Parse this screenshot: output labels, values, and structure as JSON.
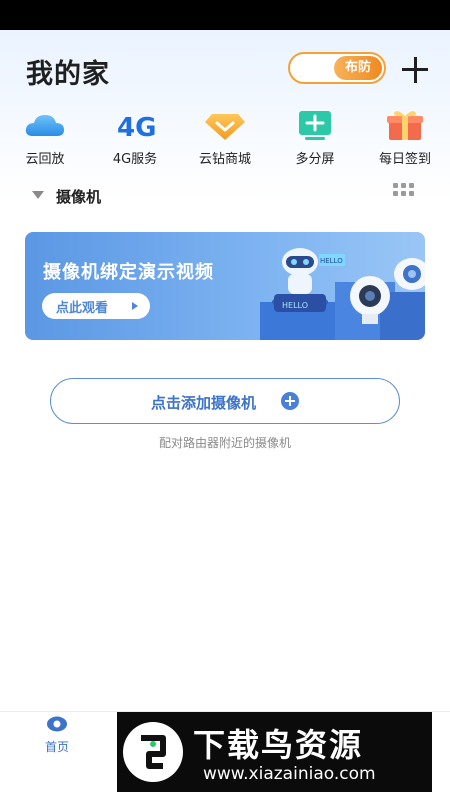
{
  "header": {
    "title": "我的家",
    "arm_label": "布防"
  },
  "quick_actions": [
    {
      "label": "云回放",
      "icon": "cloud-icon"
    },
    {
      "label": "4G服务",
      "icon": "4g-icon",
      "glyph": "4G"
    },
    {
      "label": "云钻商城",
      "icon": "diamond-icon"
    },
    {
      "label": "多分屏",
      "icon": "multi-screen-icon"
    },
    {
      "label": "每日签到",
      "icon": "gift-icon"
    }
  ],
  "category": {
    "label": "摄像机"
  },
  "banner": {
    "title": "摄像机绑定演示视频",
    "button_label": "点此观看",
    "robot_sign": "HELLO",
    "robot_base": "HELLO"
  },
  "add_camera": {
    "label": "点击添加摄像机",
    "hint": "配对路由器附近的摄像机"
  },
  "bottom_nav": {
    "home_label": "首页"
  },
  "watermark": {
    "title": "下载鸟资源",
    "url": "www.xiazainiao.com"
  },
  "colors": {
    "accent": "#3d73c9",
    "arm_orange": "#f08a21",
    "banner_blue": "#5b97e4"
  }
}
